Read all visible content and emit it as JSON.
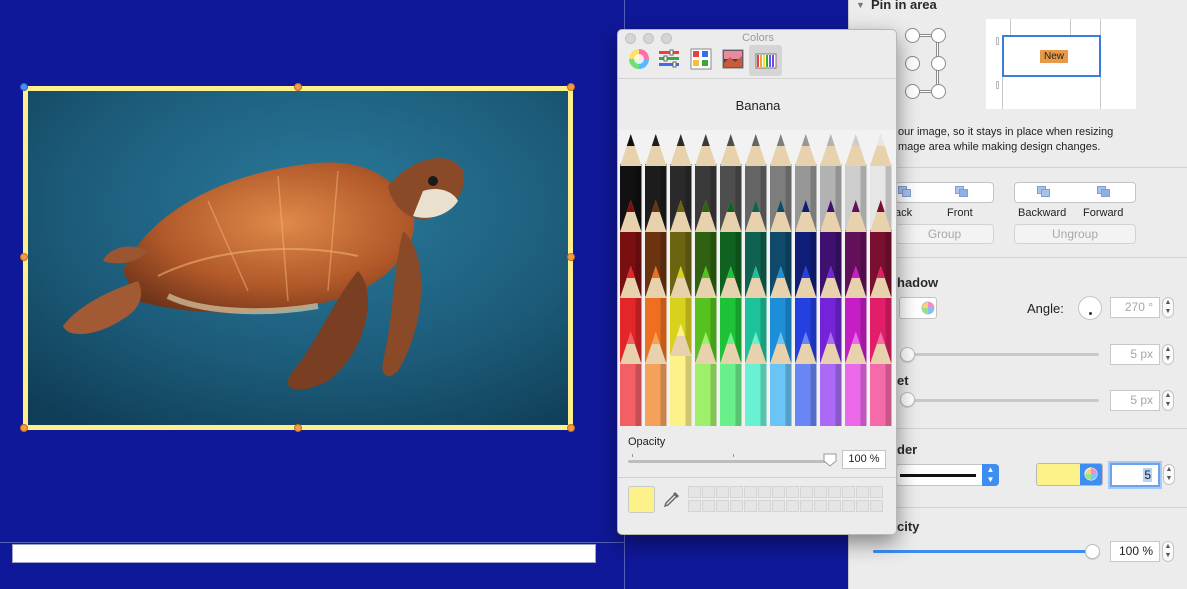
{
  "inspector": {
    "pin_heading": "Pin in area",
    "pin_description": "our image, so it stays in place when resizing\nmage area while making design changes.",
    "pin_preview_label": "New",
    "arrange": {
      "back_label": "ack",
      "front_label": "Front",
      "backward_label": "Backward",
      "forward_label": "Forward",
      "group_label": "Group",
      "ungroup_label": "Ungroup"
    },
    "shadow": {
      "heading": "hadow",
      "angle_label": "Angle:",
      "angle_value": "270 °",
      "blur_value": "5 px",
      "offset_label": "et",
      "offset_value": "5 px"
    },
    "border": {
      "heading": "der",
      "width_value": "5",
      "color": "#fdf28a"
    },
    "opacity": {
      "heading": "city",
      "value": "100 %",
      "level": 1.0
    }
  },
  "colors_panel": {
    "title": "Colors",
    "tabs": [
      "color-wheel",
      "color-sliders",
      "color-palettes",
      "image-palettes",
      "pencils"
    ],
    "selected_tab": "pencils",
    "selected_name": "Banana",
    "selected_color": "#fdf28a",
    "opacity_label": "Opacity",
    "opacity_value": "100 %",
    "opacity_level": 1.0
  },
  "canvas": {
    "background": "#10189a",
    "frame_color": "#fdf08a"
  }
}
